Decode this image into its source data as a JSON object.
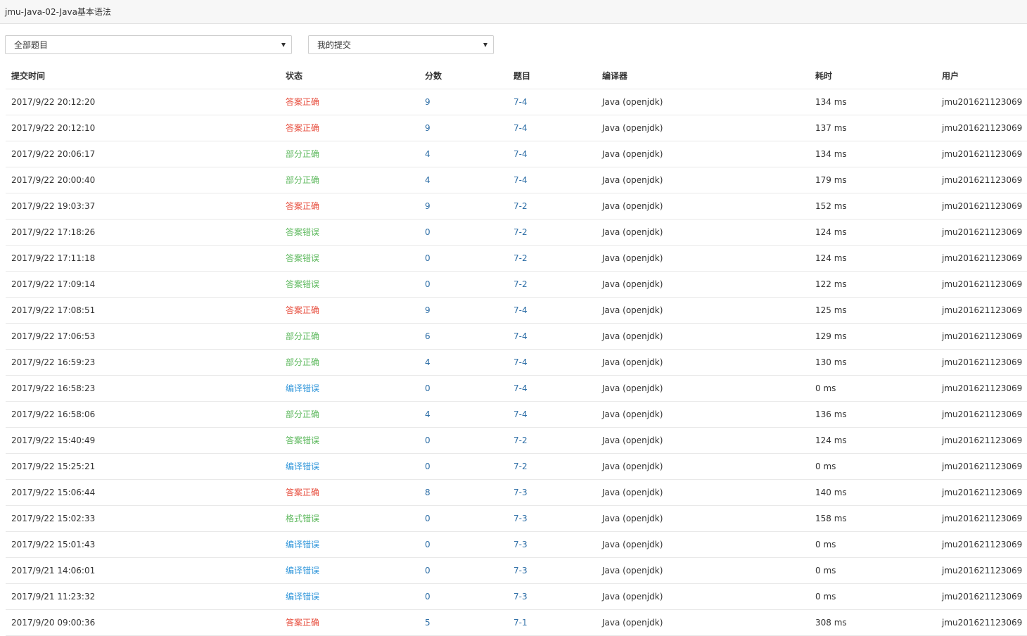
{
  "header": {
    "title": "jmu-Java-02-Java基本语法"
  },
  "filters": {
    "problem_select": "全部题目",
    "submission_select": "我的提交"
  },
  "table": {
    "columns": [
      "提交时间",
      "状态",
      "分数",
      "题目",
      "编译器",
      "耗时",
      "用户"
    ],
    "rows": [
      {
        "time": "2017/9/22 20:12:20",
        "status": "答案正确",
        "status_type": "ac",
        "score": "9",
        "problem": "7-4",
        "compiler": "Java (openjdk)",
        "elapsed": "134 ms",
        "user": "jmu201621123069"
      },
      {
        "time": "2017/9/22 20:12:10",
        "status": "答案正确",
        "status_type": "ac",
        "score": "9",
        "problem": "7-4",
        "compiler": "Java (openjdk)",
        "elapsed": "137 ms",
        "user": "jmu201621123069"
      },
      {
        "time": "2017/9/22 20:06:17",
        "status": "部分正确",
        "status_type": "pa",
        "score": "4",
        "problem": "7-4",
        "compiler": "Java (openjdk)",
        "elapsed": "134 ms",
        "user": "jmu201621123069"
      },
      {
        "time": "2017/9/22 20:00:40",
        "status": "部分正确",
        "status_type": "pa",
        "score": "4",
        "problem": "7-4",
        "compiler": "Java (openjdk)",
        "elapsed": "179 ms",
        "user": "jmu201621123069"
      },
      {
        "time": "2017/9/22 19:03:37",
        "status": "答案正确",
        "status_type": "ac",
        "score": "9",
        "problem": "7-2",
        "compiler": "Java (openjdk)",
        "elapsed": "152 ms",
        "user": "jmu201621123069"
      },
      {
        "time": "2017/9/22 17:18:26",
        "status": "答案错误",
        "status_type": "wa",
        "score": "0",
        "problem": "7-2",
        "compiler": "Java (openjdk)",
        "elapsed": "124 ms",
        "user": "jmu201621123069"
      },
      {
        "time": "2017/9/22 17:11:18",
        "status": "答案错误",
        "status_type": "wa",
        "score": "0",
        "problem": "7-2",
        "compiler": "Java (openjdk)",
        "elapsed": "124 ms",
        "user": "jmu201621123069"
      },
      {
        "time": "2017/9/22 17:09:14",
        "status": "答案错误",
        "status_type": "wa",
        "score": "0",
        "problem": "7-2",
        "compiler": "Java (openjdk)",
        "elapsed": "122 ms",
        "user": "jmu201621123069"
      },
      {
        "time": "2017/9/22 17:08:51",
        "status": "答案正确",
        "status_type": "ac",
        "score": "9",
        "problem": "7-4",
        "compiler": "Java (openjdk)",
        "elapsed": "125 ms",
        "user": "jmu201621123069"
      },
      {
        "time": "2017/9/22 17:06:53",
        "status": "部分正确",
        "status_type": "pa",
        "score": "6",
        "problem": "7-4",
        "compiler": "Java (openjdk)",
        "elapsed": "129 ms",
        "user": "jmu201621123069"
      },
      {
        "time": "2017/9/22 16:59:23",
        "status": "部分正确",
        "status_type": "pa",
        "score": "4",
        "problem": "7-4",
        "compiler": "Java (openjdk)",
        "elapsed": "130 ms",
        "user": "jmu201621123069"
      },
      {
        "time": "2017/9/22 16:58:23",
        "status": "编译错误",
        "status_type": "ce",
        "score": "0",
        "problem": "7-4",
        "compiler": "Java (openjdk)",
        "elapsed": "0 ms",
        "user": "jmu201621123069"
      },
      {
        "time": "2017/9/22 16:58:06",
        "status": "部分正确",
        "status_type": "pa",
        "score": "4",
        "problem": "7-4",
        "compiler": "Java (openjdk)",
        "elapsed": "136 ms",
        "user": "jmu201621123069"
      },
      {
        "time": "2017/9/22 15:40:49",
        "status": "答案错误",
        "status_type": "wa",
        "score": "0",
        "problem": "7-2",
        "compiler": "Java (openjdk)",
        "elapsed": "124 ms",
        "user": "jmu201621123069"
      },
      {
        "time": "2017/9/22 15:25:21",
        "status": "编译错误",
        "status_type": "ce",
        "score": "0",
        "problem": "7-2",
        "compiler": "Java (openjdk)",
        "elapsed": "0 ms",
        "user": "jmu201621123069"
      },
      {
        "time": "2017/9/22 15:06:44",
        "status": "答案正确",
        "status_type": "ac",
        "score": "8",
        "problem": "7-3",
        "compiler": "Java (openjdk)",
        "elapsed": "140 ms",
        "user": "jmu201621123069"
      },
      {
        "time": "2017/9/22 15:02:33",
        "status": "格式错误",
        "status_type": "pe",
        "score": "0",
        "problem": "7-3",
        "compiler": "Java (openjdk)",
        "elapsed": "158 ms",
        "user": "jmu201621123069"
      },
      {
        "time": "2017/9/22 15:01:43",
        "status": "编译错误",
        "status_type": "ce",
        "score": "0",
        "problem": "7-3",
        "compiler": "Java (openjdk)",
        "elapsed": "0 ms",
        "user": "jmu201621123069"
      },
      {
        "time": "2017/9/21 14:06:01",
        "status": "编译错误",
        "status_type": "ce",
        "score": "0",
        "problem": "7-3",
        "compiler": "Java (openjdk)",
        "elapsed": "0 ms",
        "user": "jmu201621123069"
      },
      {
        "time": "2017/9/21 11:23:32",
        "status": "编译错误",
        "status_type": "ce",
        "score": "0",
        "problem": "7-3",
        "compiler": "Java (openjdk)",
        "elapsed": "0 ms",
        "user": "jmu201621123069"
      },
      {
        "time": "2017/9/20 09:00:36",
        "status": "答案正确",
        "status_type": "ac",
        "score": "5",
        "problem": "7-1",
        "compiler": "Java (openjdk)",
        "elapsed": "308 ms",
        "user": "jmu201621123069"
      }
    ]
  },
  "colors": {
    "accepted": "#e74c3c",
    "partial": "#5cb85c",
    "wrong": "#5cb85c",
    "compile_error": "#3498db",
    "link": "#2f6fa7"
  }
}
